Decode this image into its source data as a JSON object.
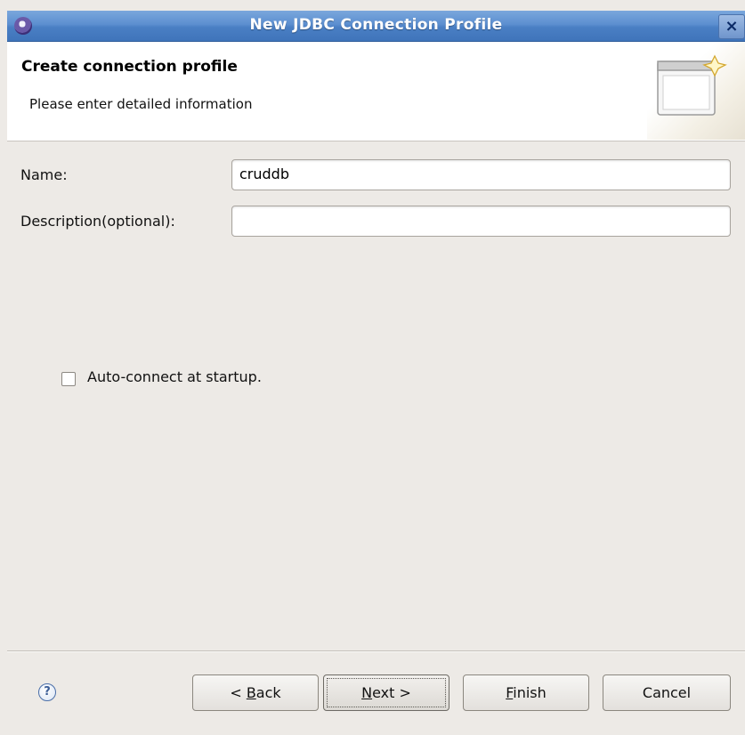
{
  "window": {
    "title": "New JDBC Connection Profile",
    "close_label": "×"
  },
  "banner": {
    "title": "Create connection profile",
    "description": "Please enter detailed information",
    "icon": "wizard-banner-icon"
  },
  "form": {
    "name_label": "Name:",
    "name_value": "cruddb",
    "description_label": "Description(optional):",
    "description_value": "",
    "auto_connect_label": "Auto-connect at startup.",
    "auto_connect_checked": false
  },
  "footer": {
    "help_symbol": "?",
    "buttons": {
      "back": {
        "prefix": "< ",
        "mnemonic": "B",
        "rest": "ack"
      },
      "next": {
        "mnemonic": "N",
        "rest": "ext >"
      },
      "finish": {
        "mnemonic": "F",
        "rest": "inish"
      },
      "cancel": {
        "label": "Cancel"
      }
    }
  }
}
